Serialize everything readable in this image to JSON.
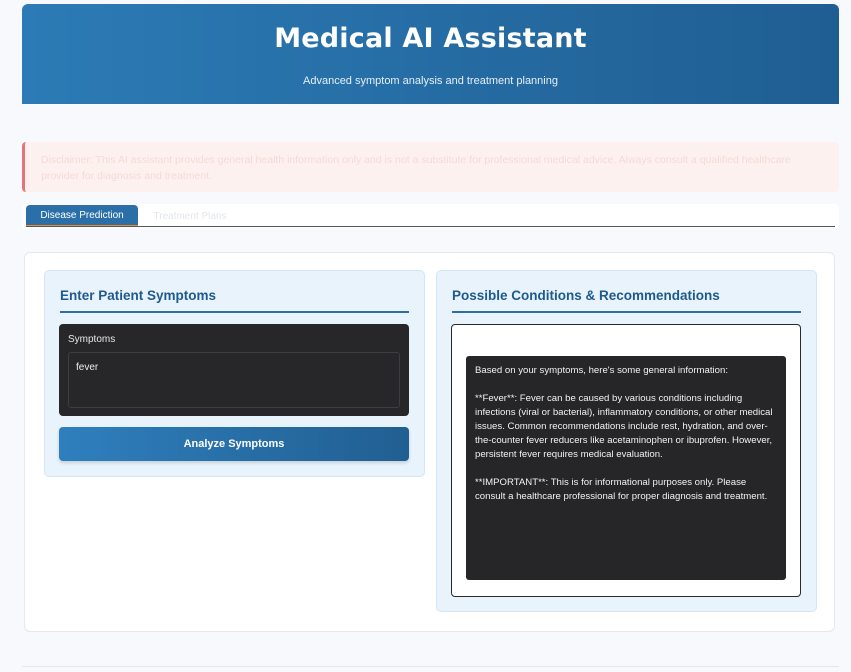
{
  "header": {
    "title": "Medical AI Assistant",
    "subtitle": "Advanced symptom analysis and treatment planning"
  },
  "disclaimer": {
    "text": "Disclaimer: This AI assistant provides general health information only and is not a substitute for professional medical advice. Always consult a qualified healthcare provider for diagnosis and treatment."
  },
  "tabs": [
    {
      "label": "Disease Prediction",
      "active": true
    },
    {
      "label": "Treatment Plans",
      "active": false
    }
  ],
  "symptoms_card": {
    "title": "Enter Patient Symptoms",
    "field_label": "Symptoms",
    "field_value": "fever",
    "button_label": "Analyze Symptoms"
  },
  "results_card": {
    "title": "Possible Conditions & Recommendations",
    "paragraphs": [
      "Based on your symptoms, here's some general information:",
      "**Fever**: Fever can be caused by various conditions including infections (viral or bacterial), inflammatory conditions, or other medical issues. Common recommendations include rest, hydration, and over-the-counter fever reducers like acetaminophen or ibuprofen. However, persistent fever requires medical evaluation.",
      "**IMPORTANT**: This is for informational purposes only. Please consult a healthcare professional for proper diagnosis and treatment."
    ]
  },
  "colors": {
    "header_start": "#2c7bb6",
    "header_end": "#1f5e92",
    "card_bg": "#e8f3fc",
    "card_title": "#1e5a8c",
    "dark_box": "#27272a",
    "disclaimer_border": "#e8727a",
    "tab_active_underline": "#f08c2c"
  }
}
